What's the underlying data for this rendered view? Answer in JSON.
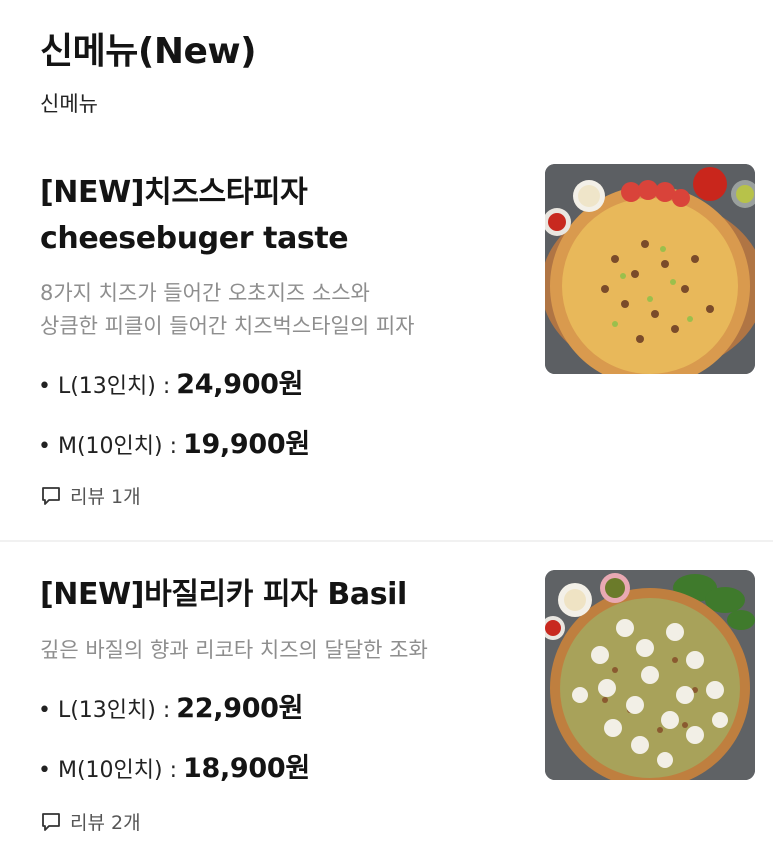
{
  "section": {
    "title": "신메뉴(New)",
    "subtitle": "신메뉴"
  },
  "items": [
    {
      "name_line1": "[NEW]치즈스타피자",
      "name_line2": "cheesebuger taste",
      "desc_line1": "8가지 치즈가 들어간 오초지즈 소스와",
      "desc_line2": "상큼한 피클이 들어간 치즈벅스타일의 피자",
      "prices": [
        {
          "size": "• L(13인치) :",
          "value": "24,900원"
        },
        {
          "size": "• M(10인치) :",
          "value": "19,900원"
        }
      ],
      "review": "리뷰 1개",
      "image_icon": "cheese-pizza-photo"
    },
    {
      "name_line1": "[NEW]바질리카 피자 Basil",
      "desc_line1": "깊은 바질의 향과 리코타 치즈의 달달한 조화",
      "prices": [
        {
          "size": "• L(13인치) :",
          "value": "22,900원"
        },
        {
          "size": "• M(10인치) :",
          "value": "18,900원"
        }
      ],
      "review": "리뷰 2개",
      "image_icon": "basil-pizza-photo"
    }
  ],
  "colors": {
    "title": "#141414",
    "description": "#8e8e8e",
    "divider": "#f1f1f1"
  }
}
